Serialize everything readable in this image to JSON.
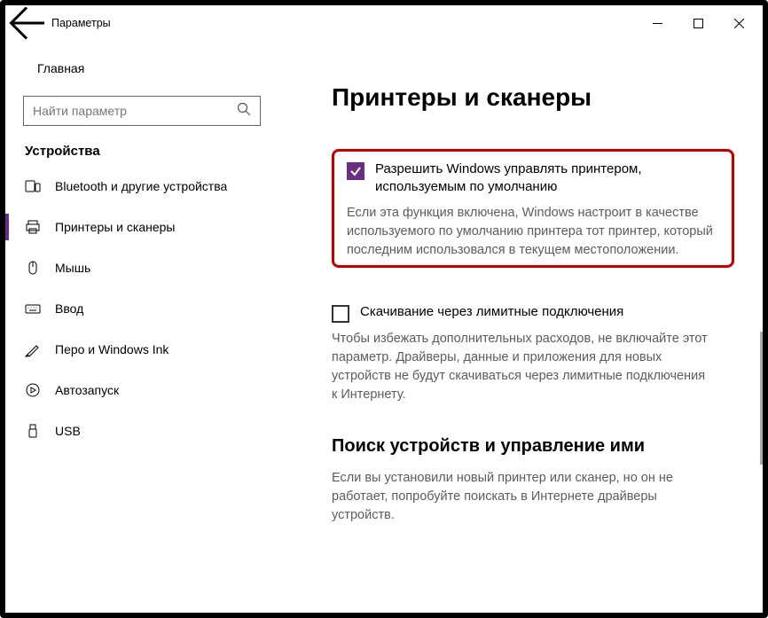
{
  "titlebar": {
    "title": "Параметры"
  },
  "sidebar": {
    "home": "Главная",
    "search_placeholder": "Найти параметр",
    "section_header": "Устройства",
    "items": [
      {
        "label": "Bluetooth и другие устройства"
      },
      {
        "label": "Принтеры и сканеры"
      },
      {
        "label": "Мышь"
      },
      {
        "label": "Ввод"
      },
      {
        "label": "Перо и Windows Ink"
      },
      {
        "label": "Автозапуск"
      },
      {
        "label": "USB"
      }
    ]
  },
  "content": {
    "heading": "Принтеры и сканеры",
    "cb1": {
      "label": "Разрешить Windows управлять принтером, используемым по умолчанию",
      "desc": "Если эта функция включена, Windows настроит в качестве используемого по умолчанию принтера тот принтер, который последним использовался в текущем местоположении."
    },
    "cb2": {
      "label": "Скачивание через лимитные подключения",
      "desc": "Чтобы избежать дополнительных расходов, не включайте этот параметр. Драйверы, данные и приложения для новых устройств не будут скачиваться через лимитные подключения к Интернету."
    },
    "sec2": {
      "heading": "Поиск устройств и управление ими",
      "desc": "Если вы установили новый принтер или сканер, но он не работает, попробуйте поискать в Интернете драйверы устройств."
    }
  }
}
